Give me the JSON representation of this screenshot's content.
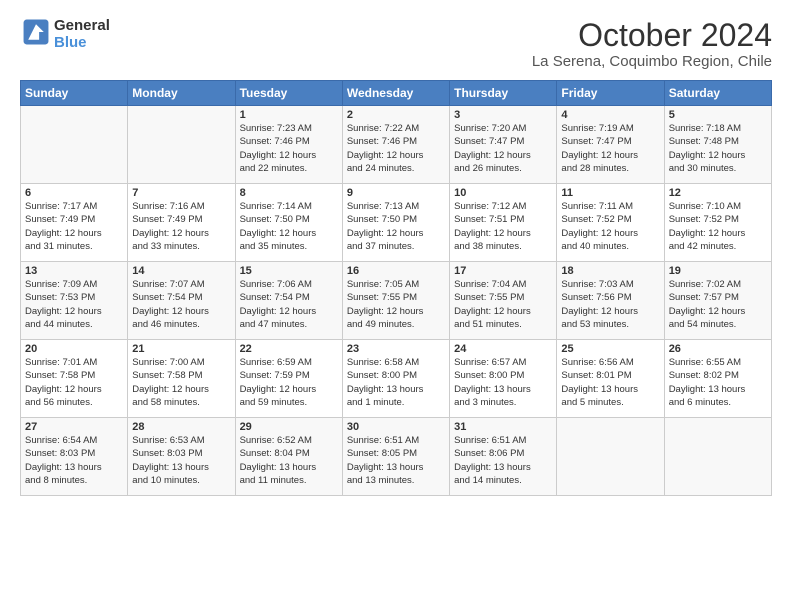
{
  "logo": {
    "line1": "General",
    "line2": "Blue"
  },
  "title": "October 2024",
  "subtitle": "La Serena, Coquimbo Region, Chile",
  "days_of_week": [
    "Sunday",
    "Monday",
    "Tuesday",
    "Wednesday",
    "Thursday",
    "Friday",
    "Saturday"
  ],
  "weeks": [
    [
      {
        "day": "",
        "info": ""
      },
      {
        "day": "",
        "info": ""
      },
      {
        "day": "1",
        "info": "Sunrise: 7:23 AM\nSunset: 7:46 PM\nDaylight: 12 hours\nand 22 minutes."
      },
      {
        "day": "2",
        "info": "Sunrise: 7:22 AM\nSunset: 7:46 PM\nDaylight: 12 hours\nand 24 minutes."
      },
      {
        "day": "3",
        "info": "Sunrise: 7:20 AM\nSunset: 7:47 PM\nDaylight: 12 hours\nand 26 minutes."
      },
      {
        "day": "4",
        "info": "Sunrise: 7:19 AM\nSunset: 7:47 PM\nDaylight: 12 hours\nand 28 minutes."
      },
      {
        "day": "5",
        "info": "Sunrise: 7:18 AM\nSunset: 7:48 PM\nDaylight: 12 hours\nand 30 minutes."
      }
    ],
    [
      {
        "day": "6",
        "info": "Sunrise: 7:17 AM\nSunset: 7:49 PM\nDaylight: 12 hours\nand 31 minutes."
      },
      {
        "day": "7",
        "info": "Sunrise: 7:16 AM\nSunset: 7:49 PM\nDaylight: 12 hours\nand 33 minutes."
      },
      {
        "day": "8",
        "info": "Sunrise: 7:14 AM\nSunset: 7:50 PM\nDaylight: 12 hours\nand 35 minutes."
      },
      {
        "day": "9",
        "info": "Sunrise: 7:13 AM\nSunset: 7:50 PM\nDaylight: 12 hours\nand 37 minutes."
      },
      {
        "day": "10",
        "info": "Sunrise: 7:12 AM\nSunset: 7:51 PM\nDaylight: 12 hours\nand 38 minutes."
      },
      {
        "day": "11",
        "info": "Sunrise: 7:11 AM\nSunset: 7:52 PM\nDaylight: 12 hours\nand 40 minutes."
      },
      {
        "day": "12",
        "info": "Sunrise: 7:10 AM\nSunset: 7:52 PM\nDaylight: 12 hours\nand 42 minutes."
      }
    ],
    [
      {
        "day": "13",
        "info": "Sunrise: 7:09 AM\nSunset: 7:53 PM\nDaylight: 12 hours\nand 44 minutes."
      },
      {
        "day": "14",
        "info": "Sunrise: 7:07 AM\nSunset: 7:54 PM\nDaylight: 12 hours\nand 46 minutes."
      },
      {
        "day": "15",
        "info": "Sunrise: 7:06 AM\nSunset: 7:54 PM\nDaylight: 12 hours\nand 47 minutes."
      },
      {
        "day": "16",
        "info": "Sunrise: 7:05 AM\nSunset: 7:55 PM\nDaylight: 12 hours\nand 49 minutes."
      },
      {
        "day": "17",
        "info": "Sunrise: 7:04 AM\nSunset: 7:55 PM\nDaylight: 12 hours\nand 51 minutes."
      },
      {
        "day": "18",
        "info": "Sunrise: 7:03 AM\nSunset: 7:56 PM\nDaylight: 12 hours\nand 53 minutes."
      },
      {
        "day": "19",
        "info": "Sunrise: 7:02 AM\nSunset: 7:57 PM\nDaylight: 12 hours\nand 54 minutes."
      }
    ],
    [
      {
        "day": "20",
        "info": "Sunrise: 7:01 AM\nSunset: 7:58 PM\nDaylight: 12 hours\nand 56 minutes."
      },
      {
        "day": "21",
        "info": "Sunrise: 7:00 AM\nSunset: 7:58 PM\nDaylight: 12 hours\nand 58 minutes."
      },
      {
        "day": "22",
        "info": "Sunrise: 6:59 AM\nSunset: 7:59 PM\nDaylight: 12 hours\nand 59 minutes."
      },
      {
        "day": "23",
        "info": "Sunrise: 6:58 AM\nSunset: 8:00 PM\nDaylight: 13 hours\nand 1 minute."
      },
      {
        "day": "24",
        "info": "Sunrise: 6:57 AM\nSunset: 8:00 PM\nDaylight: 13 hours\nand 3 minutes."
      },
      {
        "day": "25",
        "info": "Sunrise: 6:56 AM\nSunset: 8:01 PM\nDaylight: 13 hours\nand 5 minutes."
      },
      {
        "day": "26",
        "info": "Sunrise: 6:55 AM\nSunset: 8:02 PM\nDaylight: 13 hours\nand 6 minutes."
      }
    ],
    [
      {
        "day": "27",
        "info": "Sunrise: 6:54 AM\nSunset: 8:03 PM\nDaylight: 13 hours\nand 8 minutes."
      },
      {
        "day": "28",
        "info": "Sunrise: 6:53 AM\nSunset: 8:03 PM\nDaylight: 13 hours\nand 10 minutes."
      },
      {
        "day": "29",
        "info": "Sunrise: 6:52 AM\nSunset: 8:04 PM\nDaylight: 13 hours\nand 11 minutes."
      },
      {
        "day": "30",
        "info": "Sunrise: 6:51 AM\nSunset: 8:05 PM\nDaylight: 13 hours\nand 13 minutes."
      },
      {
        "day": "31",
        "info": "Sunrise: 6:51 AM\nSunset: 8:06 PM\nDaylight: 13 hours\nand 14 minutes."
      },
      {
        "day": "",
        "info": ""
      },
      {
        "day": "",
        "info": ""
      }
    ]
  ]
}
